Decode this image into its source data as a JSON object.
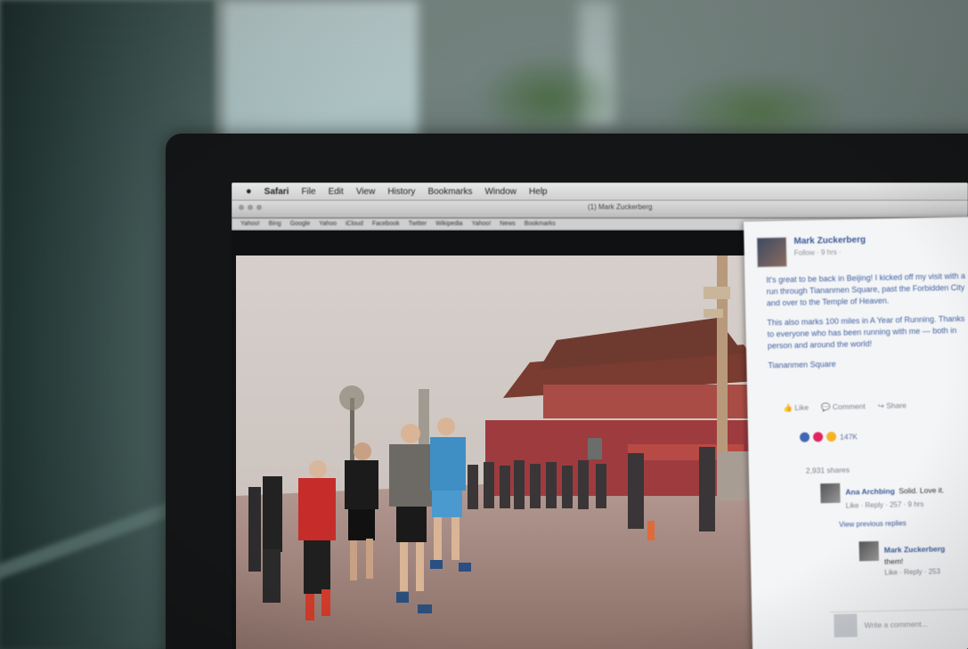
{
  "menubar": {
    "apple": "",
    "items": [
      "Safari",
      "File",
      "Edit",
      "View",
      "History",
      "Bookmarks",
      "Window",
      "Help"
    ]
  },
  "toolbar": {
    "page_title": "(1) Mark Zuckerberg"
  },
  "bookmarks": [
    "Yahoo!",
    "Bing",
    "Google",
    "Yahoo",
    "iCloud",
    "Facebook",
    "Twitter",
    "Wikipedia",
    "Yahoo!",
    "News",
    "Bookmarks"
  ],
  "facebook": {
    "author": "Mark Zuckerberg",
    "meta": "Follow · 9 hrs · ",
    "post_paragraphs": [
      "It's great to be back in Beijing! I kicked off my visit with a run through Tiananmen Square, past the Forbidden City and over to the Temple of Heaven.",
      "This also marks 100 miles in A Year of Running. Thanks to everyone who has been running with me — both in person and around the world!",
      "Tiananmen Square"
    ],
    "actions": [
      "Like",
      "Comment",
      "Share"
    ],
    "reaction_count": "147K",
    "shares": "2,931 shares",
    "comments": [
      {
        "name": "Ana Archbing",
        "text": "Solid. Love it.",
        "meta": "Like · Reply · 257 · 9 hrs"
      },
      {
        "name": "Mark Zuckerberg",
        "text": "them!",
        "meta": "Like · Reply · 253"
      }
    ],
    "view_previous": "View previous replies",
    "write_placeholder": "Write a comment..."
  },
  "colors": {
    "facebook_blue": "#3b5998",
    "runner_red": "#c62d2a",
    "gate_red": "#9e3b3f"
  }
}
